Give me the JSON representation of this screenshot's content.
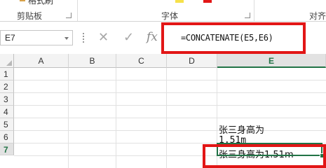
{
  "ribbon": {
    "top_partial_label": "格式刷",
    "clipboard_label": "剪贴板",
    "font_label": "字体",
    "align_label": "对齐"
  },
  "formula_bar": {
    "name_box": "E7",
    "cancel_symbol": "✕",
    "enter_symbol": "✓",
    "fx_symbol": "fx",
    "formula": "=CONCATENATE(E5,E6)"
  },
  "sheet": {
    "columns": [
      "A",
      "B",
      "C",
      "D",
      "E"
    ],
    "rows": [
      "1",
      "2",
      "3",
      "4",
      "5",
      "6",
      "7"
    ],
    "selected_column": "E",
    "cells": {
      "E5": "张三身高为",
      "E6": "1.51m",
      "E7": "张三身高为1.51m"
    }
  },
  "colors": {
    "highlight_red": "#e21616",
    "active_column_header": "#217346",
    "selection_border": "#217346"
  }
}
